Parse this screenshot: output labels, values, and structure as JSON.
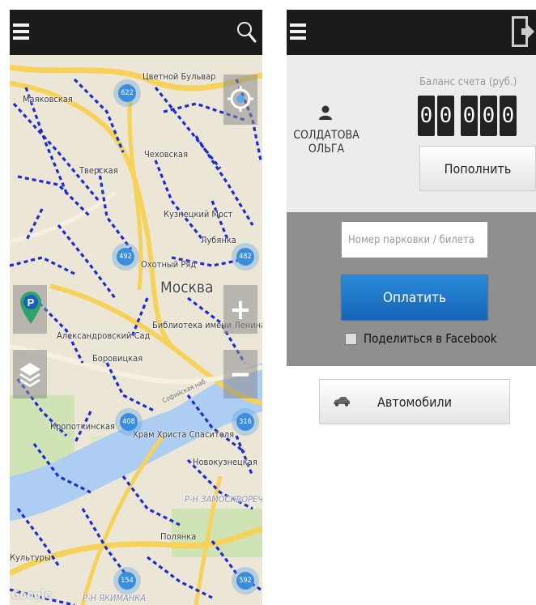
{
  "left_screen": {
    "topbar": {
      "menu_icon": "hamburger-icon",
      "search_icon": "search-icon"
    },
    "map": {
      "city_label": "Москва",
      "labels": [
        "Маяковская",
        "Цветной Бульвар",
        "Чеховская",
        "Тверская",
        "Кузнецкий Мост",
        "Лубянка",
        "Охотный Ряд",
        "Александровский Сад",
        "Библиотека имени Ленина",
        "Боровицкая",
        "Кропоткинская",
        "Храм Христа Спасителя",
        "Новокузнецкая",
        "Р-Н ЗАМОСКВОРЕЧЬЕ",
        "Полянка",
        "Культуры",
        "Р-Н ЯКИМАНКА",
        "Софийская наб."
      ],
      "clusters": [
        "622",
        "492",
        "482",
        "408",
        "316",
        "154",
        "592"
      ],
      "watermark": "Google",
      "buttons": {
        "locate_icon": "crosshair-icon",
        "parking_icon": "parking-marker-icon",
        "layers_icon": "layers-icon",
        "zoom_in": "+",
        "zoom_out": "−"
      }
    }
  },
  "right_screen": {
    "topbar": {
      "menu_icon": "hamburger-icon",
      "logout_icon": "logout-icon"
    },
    "account": {
      "user_icon": "user-icon",
      "username": "СОЛДАТОВА ОЛЬГА",
      "balance_label": "Баланс счета (руб.)",
      "balance_digits": [
        "0",
        "0",
        "0",
        "0",
        "0"
      ],
      "topup_label": "Пополнить"
    },
    "payment": {
      "ticket_placeholder": "Номер парковки / билета",
      "pay_label": "Оплатить",
      "share_label": "Поделиться в Facebook"
    },
    "cars": {
      "icon": "car-icon",
      "label": "Автомобили"
    }
  },
  "colors": {
    "topbar": "#1b1b1b",
    "accent_blue": "#1e78cc",
    "street_marks": "#1a2bd6",
    "panel_gray": "#8f8f8f"
  }
}
